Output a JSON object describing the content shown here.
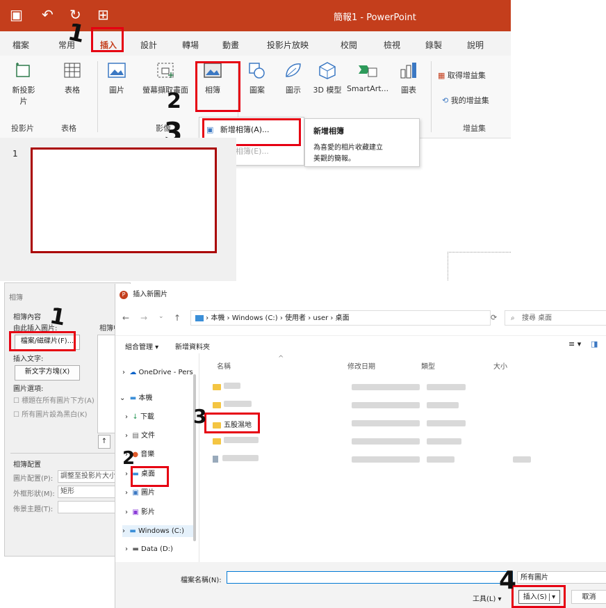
{
  "ppt": {
    "title": "簡報1 - PowerPoint",
    "tabs": [
      "檔案",
      "常用",
      "插入",
      "設計",
      "轉場",
      "動畫",
      "投影片放映",
      "校閱",
      "檢視",
      "錄製",
      "說明"
    ],
    "buttons": {
      "new_slide": "新投影片",
      "table": "表格",
      "pictures": "圖片",
      "screenshot": "螢幕擷取畫面",
      "album": "相簿",
      "shapes": "圖案",
      "icons": "圖示",
      "models3d": "3D 模型",
      "smartart": "SmartArt...",
      "chart": "圖表",
      "get_addins": "取得增益集",
      "my_addins": "我的增益集"
    },
    "groups": {
      "slides": "投影片",
      "tables": "表格",
      "images": "影像",
      "addins": "增益集"
    },
    "menu": {
      "new_album": "新增相簿(A)...",
      "edit_album": "編輯相簿(E)..."
    },
    "tooltip": {
      "title": "新增相簿",
      "desc_line1": "為喜愛的相片收藏建立",
      "desc_line2": "美觀的簡報。"
    },
    "slide_number": "1"
  },
  "album_dialog": {
    "title": "相簿",
    "content_label": "相簿內容",
    "insert_from": "由此插入圖片:",
    "album_label": "相簿中",
    "file_disk_button": "檔案/磁碟片(F)...",
    "insert_text": "插入文字:",
    "new_textbox_button": "新文字方塊(X)",
    "picture_options": "圖片選項:",
    "caption_below": "標題在所有圖片下方(A)",
    "all_bw": "所有圖片設為黑白(K)",
    "layout_label": "相簿配置",
    "picture_layout_label": "圖片配置(P):",
    "picture_layout_value": "調整至投影片大小",
    "frame_shape_label": "外框形狀(M):",
    "frame_shape_value": "矩形",
    "theme_label": "佈景主題(T):"
  },
  "file_dialog": {
    "title": "插入新圖片",
    "breadcrumb": [
      "本機",
      "Windows (C:)",
      "使用者",
      "user",
      "桌面"
    ],
    "search_placeholder": "搜尋 桌面",
    "organize": "組合管理 ▾",
    "new_folder": "新增資料夾",
    "columns": [
      "名稱",
      "修改日期",
      "類型",
      "大小"
    ],
    "nav": [
      "OneDrive - Pers",
      "本機",
      "下載",
      "文件",
      "音樂",
      "桌面",
      "圖片",
      "影片",
      "Windows (C:)",
      "Data (D:)"
    ],
    "visible_file": "五股濕地",
    "filename_label": "檔案名稱(N):",
    "filter": "所有圖片",
    "tools": "工具(L)",
    "insert_button": "插入(S)",
    "cancel_button": "取消"
  },
  "annotations": [
    "1",
    "2",
    "3",
    "1",
    "2",
    "3",
    "4"
  ]
}
